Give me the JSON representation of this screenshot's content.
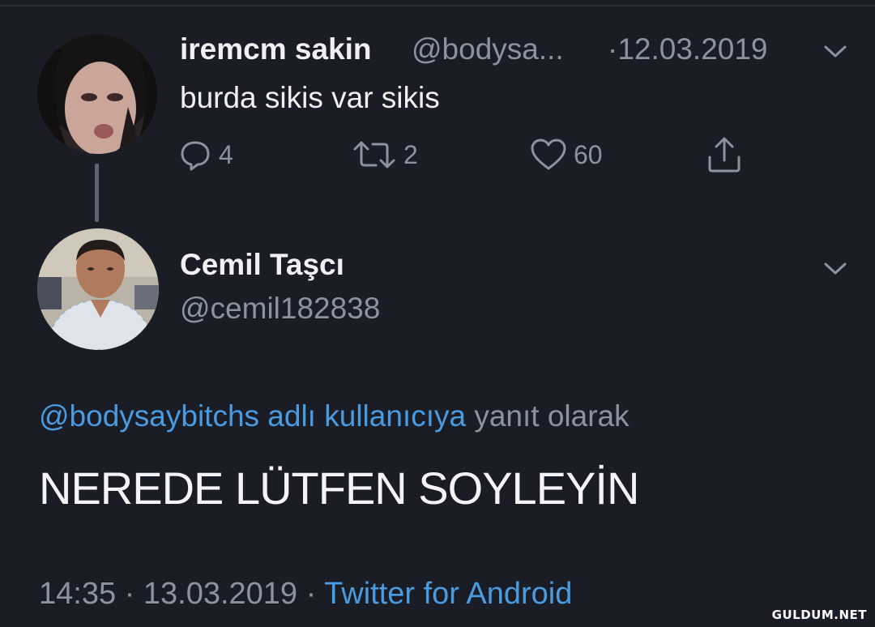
{
  "original_tweet": {
    "display_name": "iremcm sakin",
    "handle": "@bodysa...",
    "date": "·12.03.2019",
    "text": "burda sikis var sikis",
    "actions": {
      "reply_count": "4",
      "retweet_count": "2",
      "like_count": "60"
    },
    "icons": [
      "reply-icon",
      "retweet-icon",
      "like-icon",
      "share-icon",
      "chevron-down-icon"
    ]
  },
  "reply_tweet": {
    "display_name": "Cemil Taşcı",
    "handle": "@cemil182838",
    "reply_to_link": "@bodysaybitchs adlı kullanıcıya",
    "reply_to_suffix": " yanıt olarak",
    "text": "NEREDE LÜTFEN SOYLEYİN",
    "time": "14:35 · 13.03.2019 · ",
    "client": "Twitter for Android"
  },
  "watermark": "GULDUM.NET",
  "colors": {
    "background": "#1a1d26",
    "primary_text": "#eef0f4",
    "secondary_text": "#8a93a1",
    "link": "#4a9be0"
  }
}
